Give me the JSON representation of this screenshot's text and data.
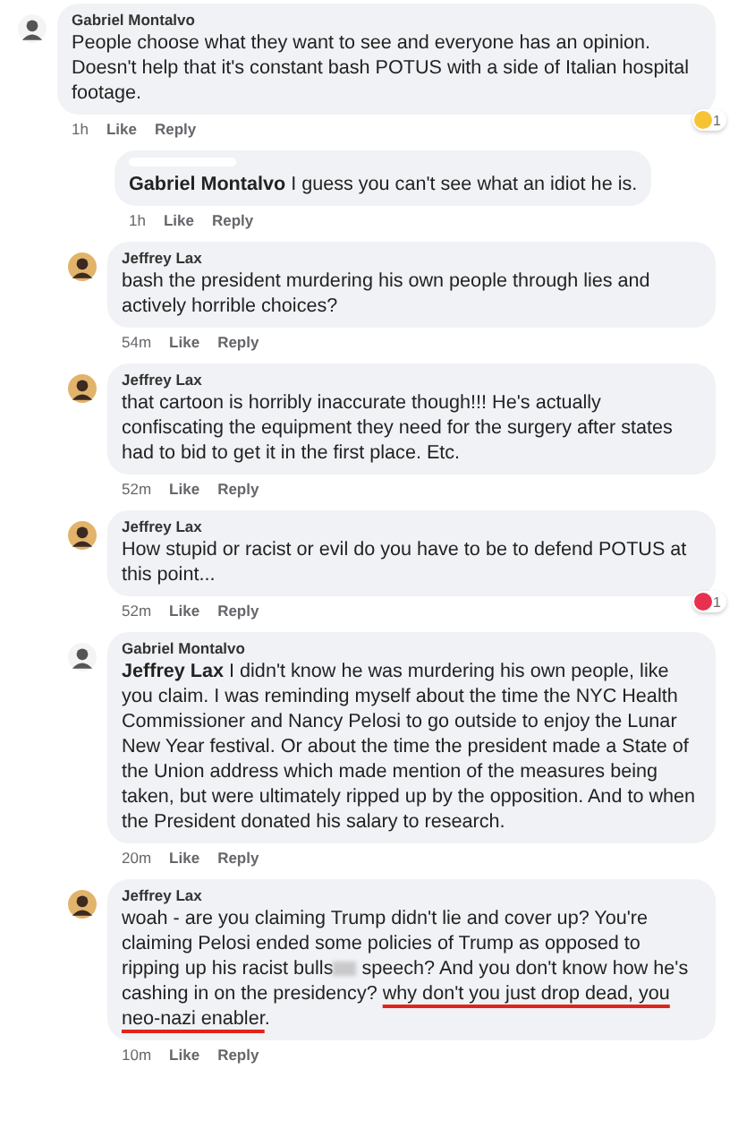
{
  "comments": [
    {
      "author": "Gabriel Montalvo",
      "kind": "sketch",
      "body": [
        {
          "kind": "text",
          "text": "People choose what they want to see and everyone has an opinion. Doesn't help that it's constant bash POTUS with a side of Italian hospital footage."
        }
      ],
      "time": "1h",
      "like": "Like",
      "reply": "Reply",
      "reaction": {
        "kind": "haha",
        "count": "1"
      },
      "children": [
        {
          "kind": "hidden",
          "body": [
            {
              "kind": "mention",
              "text": "Gabriel Montalvo"
            },
            {
              "kind": "text",
              "text": " I guess you can't see what an idiot he is."
            }
          ],
          "time": "1h",
          "like": "Like",
          "reply": "Reply"
        },
        {
          "author": "Jeffrey Lax",
          "kind": "photo",
          "body": [
            {
              "kind": "text",
              "text": "bash the president murdering his own people through lies and actively horrible choices?"
            }
          ],
          "time": "54m",
          "like": "Like",
          "reply": "Reply"
        },
        {
          "author": "Jeffrey Lax",
          "kind": "photo",
          "body": [
            {
              "kind": "text",
              "text": "that cartoon is horribly inaccurate though!!! He's actually confiscating the equipment they need for the surgery after states had to bid to get it in the first place.  Etc."
            }
          ],
          "time": "52m",
          "like": "Like",
          "reply": "Reply"
        },
        {
          "author": "Jeffrey Lax",
          "kind": "photo",
          "body": [
            {
              "kind": "text",
              "text": "How stupid or racist or evil do you have to be to defend POTUS at this point..."
            }
          ],
          "time": "52m",
          "like": "Like",
          "reply": "Reply",
          "reaction": {
            "kind": "love",
            "count": "1"
          }
        },
        {
          "author": "Gabriel Montalvo",
          "kind": "sketch",
          "body": [
            {
              "kind": "mention",
              "text": "Jeffrey Lax"
            },
            {
              "kind": "text",
              "text": " I didn't know he was murdering his own people, like you claim. I was reminding myself about the time the NYC Health Commissioner and Nancy Pelosi to go outside to enjoy the Lunar New Year festival. Or about the time the president made a State of the Union address which made mention of the measures being taken, but were ultimately ripped up by the opposition. And to when the President donated his salary to research."
            }
          ],
          "time": "20m",
          "like": "Like",
          "reply": "Reply"
        },
        {
          "author": "Jeffrey Lax",
          "kind": "photo",
          "body": [
            {
              "kind": "text",
              "text": "woah - are you claiming Trump didn't lie and cover up?  You're claiming Pelosi ended some policies of Trump as opposed to ripping up his racist bulls"
            },
            {
              "kind": "censored"
            },
            {
              "kind": "text",
              "text": " speech?  And you don't know how he's cashing in on the presidency?  "
            },
            {
              "kind": "underlined",
              "text": "why don't you just drop dead, you neo-nazi enabler"
            },
            {
              "kind": "text",
              "text": "."
            }
          ],
          "time": "10m",
          "like": "Like",
          "reply": "Reply"
        }
      ]
    }
  ]
}
